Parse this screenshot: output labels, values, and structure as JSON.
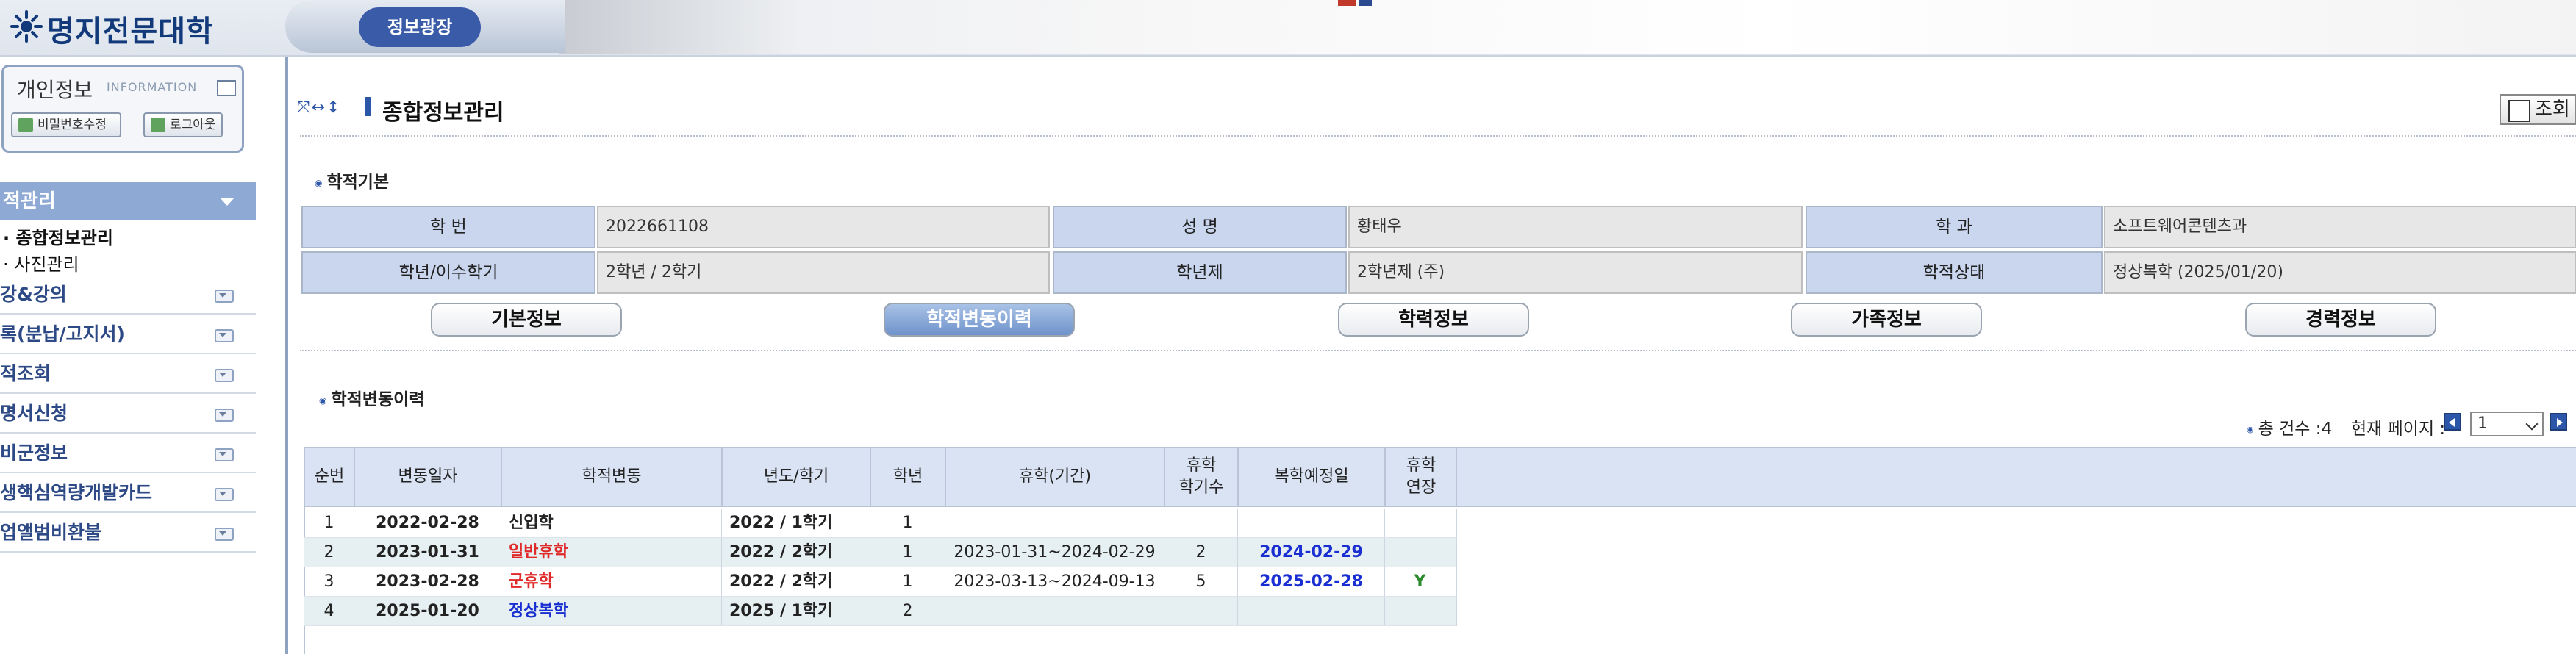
{
  "header": {
    "logo_text": "명지전문대학",
    "nav_pill": "정보광장"
  },
  "sidebar": {
    "info_title": "개인정보",
    "info_sub": "INFORMATION",
    "pw_button": "비밀번호수정",
    "logout_button": "로그아웃",
    "active_menu": "적관리",
    "submenus": [
      "· 종합정보관리",
      "· 사진관리"
    ],
    "menus": [
      "강&강의",
      "록(분납/고지서)",
      "적조회",
      "명서신청",
      "비군정보",
      "생핵심역량개발카드",
      "업앨범비환불"
    ]
  },
  "main": {
    "toolbar_icons": "⤧↔↕",
    "title": "종합정보관리",
    "search_button": "조회",
    "section_basic": "학적기본",
    "section_history": "학적변동이력"
  },
  "basic": {
    "rows": [
      [
        {
          "label": "학    번",
          "value": "2022661108"
        },
        {
          "label": "성    명",
          "value": "황태우"
        },
        {
          "label": "학    과",
          "value": "소프트웨어콘텐츠과"
        }
      ],
      [
        {
          "label": "학년/이수학기",
          "value": "2학년 / 2학기"
        },
        {
          "label": "학년제",
          "value": "2학년제 (주)"
        },
        {
          "label": "학적상태",
          "value": "정상복학 (2025/01/20)"
        }
      ]
    ]
  },
  "tabs": [
    "기본정보",
    "학적변동이력",
    "학력정보",
    "가족정보",
    "경력정보"
  ],
  "pager": {
    "count_text": "총 건수 :4",
    "current_label": "현재 페이지 :",
    "page": "1"
  },
  "history": {
    "headers": [
      "순번",
      "변동일자",
      "학적변동",
      "년도/학기",
      "학년",
      "휴학(기간)",
      "휴학\n학기수",
      "복학예정일",
      "휴학\n연장"
    ],
    "rows": [
      [
        "1",
        "2022-02-28",
        "신입학",
        "2022 / 1학기",
        "1",
        "",
        "",
        "",
        ""
      ],
      [
        "2",
        "2023-01-31",
        "일반휴학",
        "2022 / 2학기",
        "1",
        "2023-01-31~2024-02-29",
        "2",
        "2024-02-29",
        ""
      ],
      [
        "3",
        "2023-02-28",
        "군휴학",
        "2022 / 2학기",
        "1",
        "2023-03-13~2024-09-13",
        "5",
        "2025-02-28",
        "Y"
      ],
      [
        "4",
        "2025-01-20",
        "정상복학",
        "2025 / 1학기",
        "2",
        "",
        "",
        "",
        ""
      ]
    ]
  },
  "colors": {
    "accent": "#2c56a8",
    "header_cell": "#c9d6ee",
    "leave_status": "#e02a2a",
    "return_status": "#1a2fd1"
  }
}
